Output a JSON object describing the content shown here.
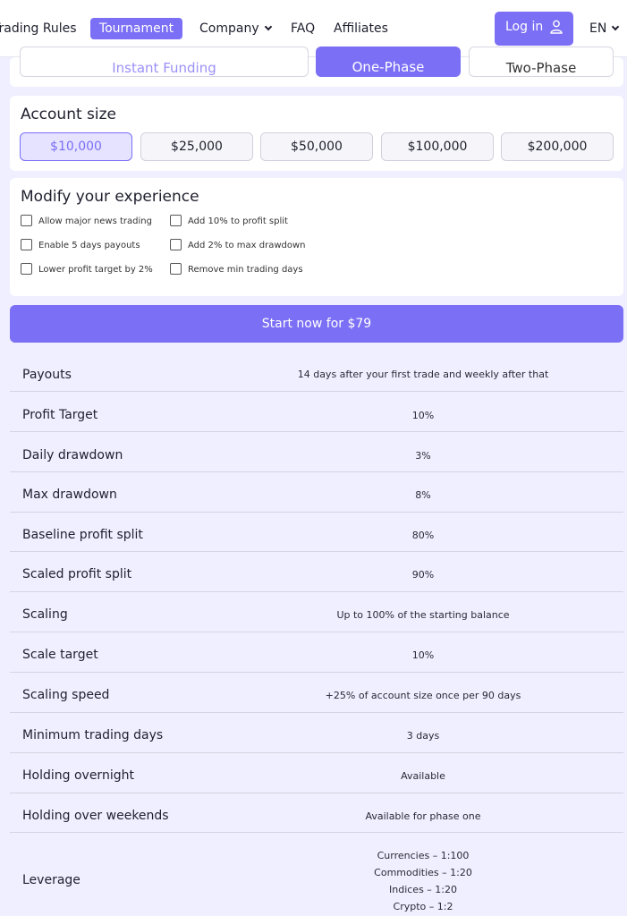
{
  "header": {
    "nav": [
      "Trading Rules",
      "Tournament",
      "Company",
      "FAQ",
      "Affiliates"
    ],
    "login_label": "Log in",
    "language": "EN"
  },
  "phases": [
    "Instant Funding",
    "One-Phase",
    "Two-Phase"
  ],
  "account_size": {
    "title": "Account size",
    "options": [
      "$10,000",
      "$25,000",
      "$50,000",
      "$100,000",
      "$200,000"
    ],
    "selected": "$10,000"
  },
  "modify": {
    "title": "Modify your experience",
    "options_left": [
      "Allow major news trading",
      "Enable 5 days payouts",
      "Lower profit target by 2%"
    ],
    "options_right": [
      "Add 10% to profit split",
      "Add 2% to max drawdown",
      "Remove min trading days"
    ]
  },
  "cta_label": "Start now for $79",
  "rules": [
    {
      "label": "Payouts",
      "value": "14 days after your first trade and weekly after that"
    },
    {
      "label": "Profit Target",
      "value": "10%"
    },
    {
      "label": "Daily drawdown",
      "value": "3%"
    },
    {
      "label": "Max drawdown",
      "value": "8%"
    },
    {
      "label": "Baseline profit split",
      "value": "80%"
    },
    {
      "label": "Scaled profit split",
      "value": "90%"
    },
    {
      "label": "Scaling",
      "value": "Up to 100% of the starting balance"
    },
    {
      "label": "Scale target",
      "value": "10%"
    },
    {
      "label": "Scaling speed",
      "value": "+25% of account size once per 90 days"
    },
    {
      "label": "Minimum trading days",
      "value": "3 days"
    },
    {
      "label": "Holding overnight",
      "value": "Available"
    },
    {
      "label": "Holding over weekends",
      "value": "Available for phase one"
    }
  ],
  "leverage": {
    "label": "Leverage",
    "values": [
      "Currencies – 1:100",
      "Commodities – 1:20",
      "Indices – 1:20",
      "Crypto – 1:2"
    ]
  },
  "colors": {
    "accent": "#7b6ff5",
    "page_bg": "#efefff"
  },
  "icons": [
    "user-icon",
    "chevron-down-icon"
  ]
}
